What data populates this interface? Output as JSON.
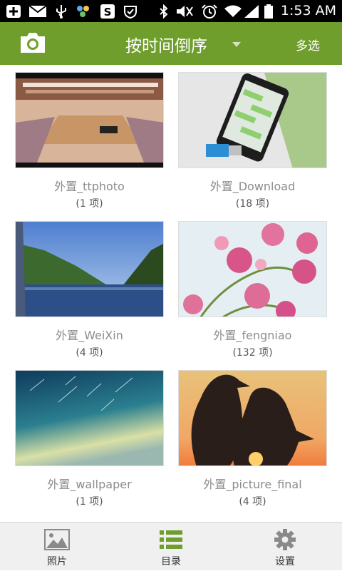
{
  "status_bar": {
    "time": "1:53 AM",
    "icons": [
      "add-icon",
      "mail-icon",
      "usb-icon",
      "app-icon",
      "s-app-icon",
      "vpn-icon",
      "bluetooth-icon",
      "mute-icon",
      "alarm-icon",
      "wifi-icon",
      "signal-icon",
      "battery-icon"
    ]
  },
  "header": {
    "camera_icon": "camera-icon",
    "sort_label": "按时间倒序",
    "sort_dropdown_icon": "caret-down-icon",
    "multi_select_label": "多选",
    "accent_color": "#6f9e2d"
  },
  "albums": [
    {
      "name": "外置_ttphoto",
      "count": "(1 项)"
    },
    {
      "name": "外置_Download",
      "count": "(18 项)"
    },
    {
      "name": "外置_WeiXin",
      "count": "(4 项)"
    },
    {
      "name": "外置_fengniao",
      "count": "(132 项)"
    },
    {
      "name": "外置_wallpaper",
      "count": "(1 项)"
    },
    {
      "name": "外置_picture_final",
      "count": "(4 项)"
    }
  ],
  "tabs": [
    {
      "label": "照片",
      "icon": "photo-icon",
      "active": false
    },
    {
      "label": "目录",
      "icon": "list-icon",
      "active": true
    },
    {
      "label": "设置",
      "icon": "gear-icon",
      "active": false
    }
  ]
}
